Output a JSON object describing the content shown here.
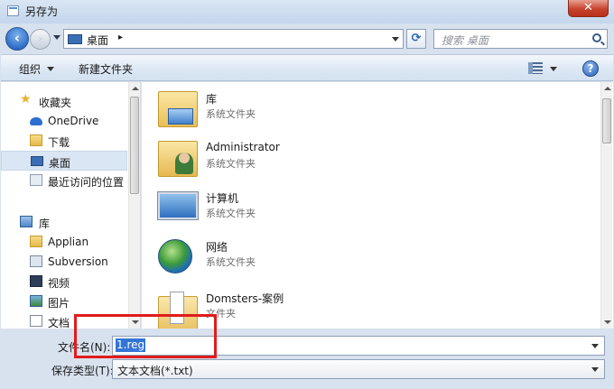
{
  "window": {
    "title": "另存为",
    "close_glyph": "✕"
  },
  "address": {
    "location": "桌面",
    "separator": "▸",
    "search_placeholder": "搜索 桌面"
  },
  "toolbar": {
    "organize": "组织",
    "new_folder": "新建文件夹",
    "help": "?"
  },
  "nav": {
    "items": [
      {
        "label": "收藏夹",
        "icon": "star-icon"
      },
      {
        "label": "OneDrive",
        "icon": "onedrive-icon"
      },
      {
        "label": "下载",
        "icon": "download-folder-icon"
      },
      {
        "label": "桌面",
        "icon": "desktop-icon",
        "selected": true
      },
      {
        "label": "最近访问的位置",
        "icon": "recent-places-icon"
      },
      {
        "label": "库",
        "icon": "library-icon"
      },
      {
        "label": "Applian",
        "icon": "folder-icon"
      },
      {
        "label": "Subversion",
        "icon": "subversion-icon"
      },
      {
        "label": "视频",
        "icon": "video-icon"
      },
      {
        "label": "图片",
        "icon": "pictures-icon"
      },
      {
        "label": "文档",
        "icon": "documents-icon"
      }
    ]
  },
  "files": [
    {
      "name": "库",
      "type": "系统文件夹",
      "icon": "library-folder-icon"
    },
    {
      "name": "Administrator",
      "type": "系统文件夹",
      "icon": "user-folder-icon"
    },
    {
      "name": "计算机",
      "type": "系统文件夹",
      "icon": "computer-icon"
    },
    {
      "name": "网络",
      "type": "系统文件夹",
      "icon": "network-icon"
    },
    {
      "name": "Domsters-案例",
      "type": "文件夹",
      "icon": "folder-icon"
    }
  ],
  "save": {
    "filename_label": "文件名(N):",
    "filename_value": "1.reg",
    "filetype_label": "保存类型(T):",
    "filetype_value": "文本文档(*.txt)"
  }
}
